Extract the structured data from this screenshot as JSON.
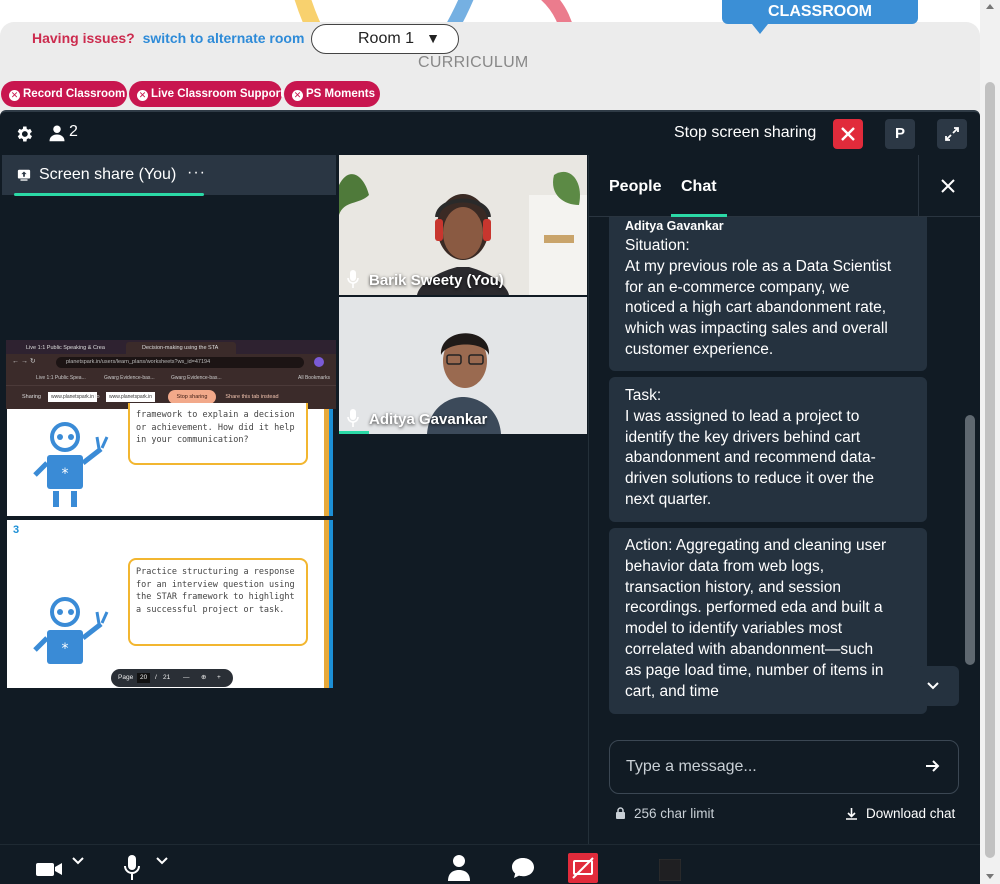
{
  "portal": {
    "issues_text": "Having issues?",
    "alternate_link": "switch to alternate room",
    "room_value": "Room 1",
    "classroom_tab": "CLASSROOM",
    "curriculum": "CURRICULUM",
    "pills": [
      "Record Classroom",
      "Live Classroom Support",
      "PS Moments"
    ]
  },
  "meeting": {
    "participant_count": "2",
    "stop_sharing": "Stop screen sharing",
    "profile_initial": "P",
    "screen_share_label": "Screen share (You)",
    "screen_share_menu": "···",
    "participants": [
      {
        "name": "Barik Sweety (You)"
      },
      {
        "name": "Aditya Gavankar"
      }
    ]
  },
  "shared_screen": {
    "tabs": [
      "Live 1:1 Public Speaking & Crea",
      "Decision-making using the STA"
    ],
    "url": "planetspark.in/users/learn_plans/worksheets?ws_id=47194",
    "bookmarks": [
      "Live 1:1 Public Spea...",
      "Gwarg Evidence-bas...",
      "Gwarg Evidence-bas...",
      "All Bookmarks"
    ],
    "sharing_label": "Sharing",
    "sharing_from": "www.planetspark.in",
    "sharing_to_label": "to",
    "sharing_to": "www.planetspark.in",
    "stop_sharing": "Stop sharing",
    "share_tab_instead": "Share this tab instead",
    "card1_text": "framework to explain a decision or achievement. How did it help in your communication?",
    "card2_number": "3",
    "card2_text": "Practice structuring a response for an interview question using the STAR framework to highlight a successful project or task.",
    "pager_label": "Page",
    "pager_current": "20",
    "pager_sep": "/",
    "pager_total": "21",
    "pager_minus": "—",
    "pager_plus": "+"
  },
  "chat": {
    "tab_people": "People",
    "tab_chat": "Chat",
    "messages": [
      {
        "sender": "Aditya Gavankar",
        "lines": [
          "Situation:",
          "At my previous role as a Data Scientist",
          "for an e-commerce company, we",
          "noticed a high cart abandonment rate,",
          "which was impacting sales and overall",
          "customer experience."
        ]
      },
      {
        "lines": [
          "Task:",
          "I was assigned to lead a project to",
          "identify the key drivers behind cart",
          "abandonment and recommend data-",
          "driven solutions to reduce it over the",
          "next quarter."
        ]
      },
      {
        "lines": [
          "Action: Aggregating and cleaning user",
          "behavior data from web logs,",
          "transaction history, and session",
          "recordings. performed eda and built a",
          "model to identify variables most",
          "correlated with abandonment—such",
          "as page load time, number of items in",
          "cart, and time"
        ]
      }
    ],
    "input_placeholder": "Type a message...",
    "char_limit": "256 char limit",
    "download": "Download chat"
  },
  "colors": {
    "accent_green": "#2bd9a6",
    "stop_red": "#e12b3b",
    "brand_pink": "#c8164f",
    "link_blue": "#2e8bd8"
  }
}
